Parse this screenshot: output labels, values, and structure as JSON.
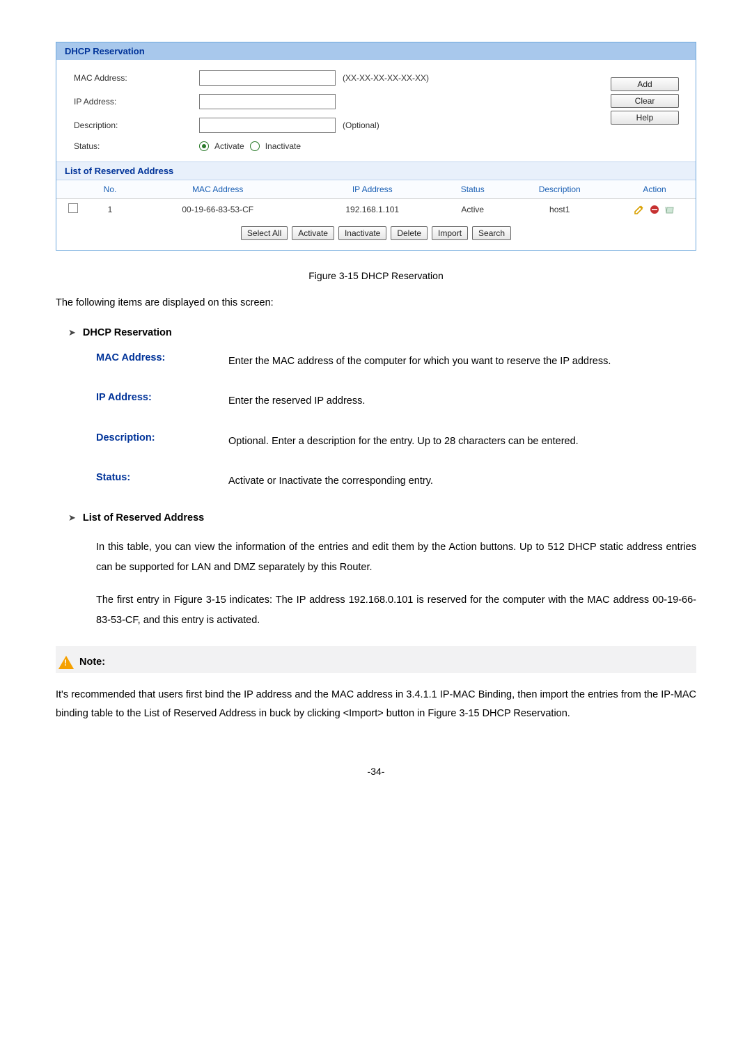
{
  "panel_title": "DHCP Reservation",
  "form": {
    "mac_label": "MAC Address:",
    "mac_hint": "(XX-XX-XX-XX-XX-XX)",
    "ip_label": "IP Address:",
    "desc_label": "Description:",
    "desc_hint": "(Optional)",
    "status_label": "Status:",
    "activate": "Activate",
    "inactivate": "Inactivate"
  },
  "buttons": {
    "add": "Add",
    "clear": "Clear",
    "help": "Help",
    "select_all": "Select All",
    "activate": "Activate",
    "inactivate": "Inactivate",
    "delete": "Delete",
    "import": "Import",
    "search": "Search"
  },
  "list_title": "List of Reserved Address",
  "table": {
    "headers": {
      "no": "No.",
      "mac": "MAC Address",
      "ip": "IP Address",
      "status": "Status",
      "desc": "Description",
      "action": "Action"
    },
    "row": {
      "no": "1",
      "mac": "00-19-66-83-53-CF",
      "ip": "192.168.1.101",
      "status": "Active",
      "desc": "host1"
    }
  },
  "caption": "Figure 3-15 DHCP Reservation",
  "intro": "The following items are displayed on this screen:",
  "sec1": "DHCP Reservation",
  "defs": {
    "mac_l": "MAC Address:",
    "mac_t": "Enter the MAC address of the computer for which you want to reserve the IP address.",
    "ip_l": "IP Address:",
    "ip_t": "Enter the reserved IP address.",
    "desc_l": "Description:",
    "desc_t": "Optional. Enter a description for the entry. Up to 28 characters can be entered.",
    "status_l": "Status:",
    "status_t": "Activate or Inactivate the corresponding entry."
  },
  "sec2": "List of Reserved Address",
  "para1": "In this table, you can view the information of the entries and edit them by the Action buttons. Up to 512 DHCP static address entries can be supported for LAN and DMZ separately by this Router.",
  "para2": "The first entry in Figure 3-15 indicates: The IP address 192.168.0.101 is reserved for the computer with the MAC address 00-19-66-83-53-CF, and this entry is activated.",
  "note_title": "Note:",
  "note_body": "It's recommended that users first bind the IP address and the MAC address in 3.4.1.1 IP-MAC Binding, then import the entries from the IP-MAC binding table to the List of Reserved Address in buck by clicking <Import> button in Figure 3-15 DHCP Reservation.",
  "page": "-34-"
}
